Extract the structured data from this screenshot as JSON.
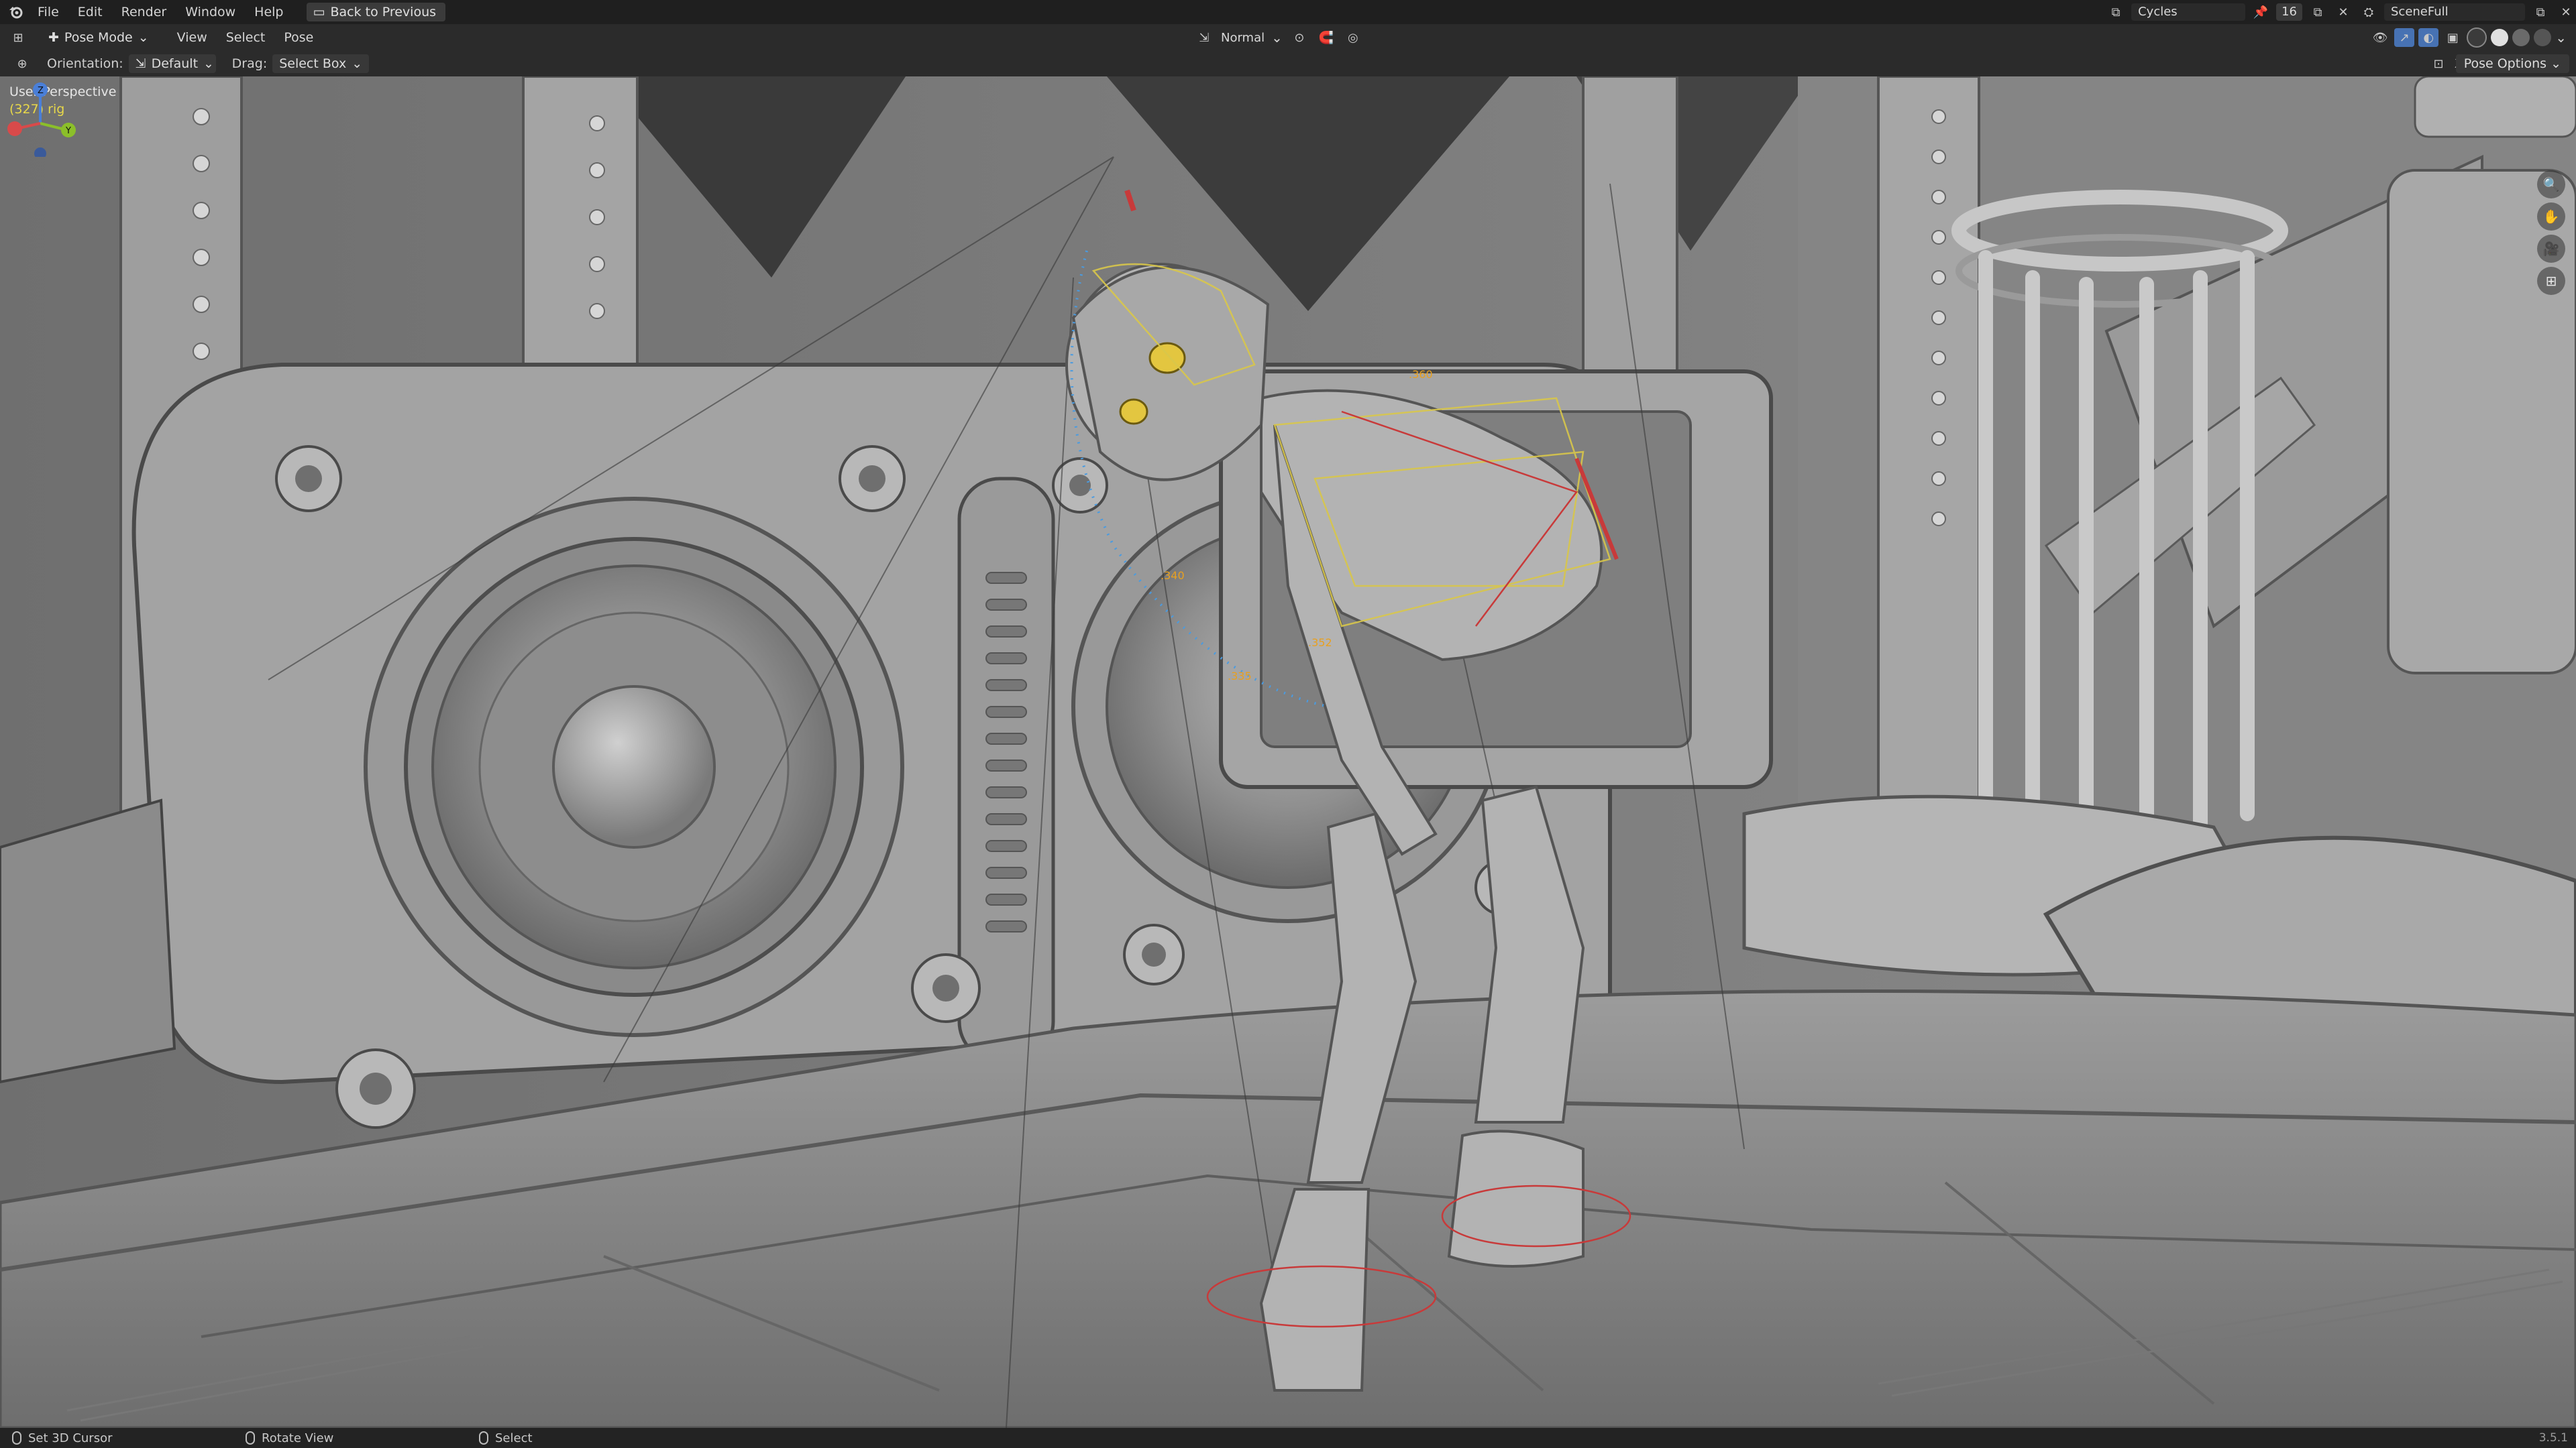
{
  "menu": {
    "items": [
      "File",
      "Edit",
      "Render",
      "Window",
      "Help"
    ],
    "back_button": "Back to Previous"
  },
  "topbar_right": {
    "render_engine": "Cycles",
    "count": "16",
    "scene": "SceneFull"
  },
  "header": {
    "mode": "Pose Mode",
    "menus": [
      "View",
      "Select",
      "Pose"
    ],
    "transform_orientation": "Normal"
  },
  "tool_settings": {
    "orientation_label": "Orientation:",
    "orientation_value": "Default",
    "drag_label": "Drag:",
    "drag_value": "Select Box",
    "pose_options": "Pose Options"
  },
  "viewport": {
    "view_name": "User Perspective",
    "object_info": "(327) rig",
    "info_color": "#e8d84a",
    "active_bone_color": "#e8a020",
    "constraint_color": "#c83a3a"
  },
  "statusbar": {
    "items": [
      "Set 3D Cursor",
      "Rotate View",
      "Select"
    ],
    "version": "3.5.1"
  },
  "icons": [
    "blender-logo",
    "pose-mode-icon",
    "transform-pivot-icon",
    "snap-icon",
    "proportional-edit-icon",
    "viewport-shading-solid-icon",
    "nav-gizmo",
    "zoom-icon",
    "pan-icon",
    "camera-icon",
    "grid-icon"
  ]
}
